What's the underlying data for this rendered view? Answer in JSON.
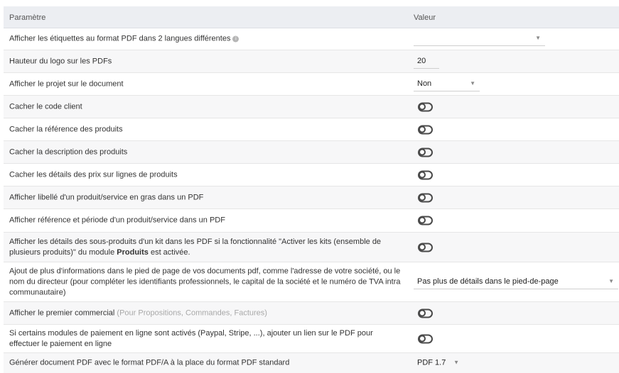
{
  "header": {
    "col_param": "Paramètre",
    "col_value": "Valeur"
  },
  "rows": [
    {
      "label": "Afficher les étiquettes au format PDF dans 2 langues différentes",
      "info": "i",
      "type": "select",
      "value": ""
    },
    {
      "label": "Hauteur du logo sur les PDFs",
      "type": "input",
      "value": "20"
    },
    {
      "label": "Afficher le projet sur le document",
      "type": "select",
      "value": "Non"
    },
    {
      "label": "Cacher le code client",
      "type": "toggle",
      "state": "off"
    },
    {
      "label": "Cacher la référence des produits",
      "type": "toggle",
      "state": "off"
    },
    {
      "label": "Cacher la description des produits",
      "type": "toggle",
      "state": "off"
    },
    {
      "label": "Cacher les détails des prix sur lignes de produits",
      "type": "toggle",
      "state": "off"
    },
    {
      "label": "Afficher libellé d'un produit/service en gras dans un PDF",
      "type": "toggle",
      "state": "off"
    },
    {
      "label": "Afficher référence et période d'un produit/service dans un PDF",
      "type": "toggle",
      "state": "off"
    },
    {
      "label_pre": "Afficher les détails des sous-produits d'un kit dans les PDF si la fonctionnalité \"Activer les kits (ensemble de plusieurs produits)\" du module ",
      "label_strong": "Produits",
      "label_post": " est activée.",
      "type": "toggle",
      "state": "off"
    },
    {
      "label": "Ajout de plus d'informations dans le pied de page de vos documents pdf, comme l'adresse de votre société, ou le nom du directeur (pour compléter les identifiants professionnels, le capital de la société et le numéro de TVA intra communautaire)",
      "type": "select",
      "value": "Pas plus de détails dans le pied-de-page"
    },
    {
      "label": "Afficher le premier commercial",
      "hint": "(Pour Propositions, Commandes, Factures)",
      "type": "toggle",
      "state": "off"
    },
    {
      "label": "Si certains modules de paiement en ligne sont activés (Paypal, Stripe, ...), ajouter un lien sur le PDF pour effectuer le paiement en ligne",
      "type": "toggle",
      "state": "off"
    },
    {
      "label": "Générer document PDF avec le format PDF/A à la place du format PDF standard",
      "type": "select",
      "value": "PDF 1.7"
    }
  ],
  "caret": "▼"
}
